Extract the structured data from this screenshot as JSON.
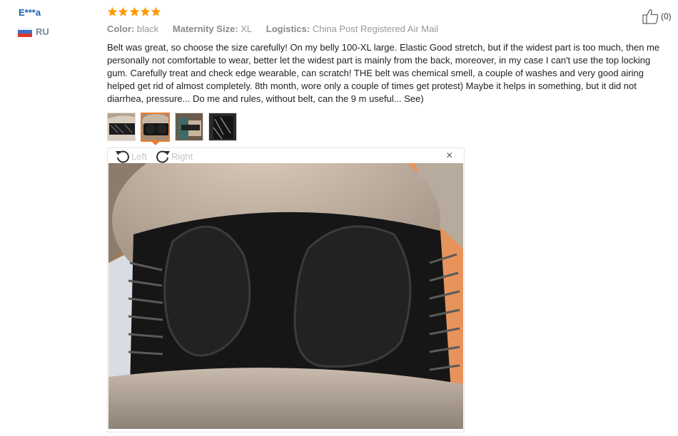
{
  "user": {
    "name": "E***a",
    "country": "RU"
  },
  "review": {
    "rating": 5,
    "attributes": [
      {
        "label": "Color:",
        "value": "black"
      },
      {
        "label": "Maternity Size:",
        "value": "XL"
      },
      {
        "label": "Logistics:",
        "value": "China Post Registered Air Mail"
      }
    ],
    "text": "Belt was great, so choose the size carefully! On my belly 100-XL large. Elastic Good stretch, but if the widest part is too much, then me personally not comfortable to wear, better let the widest part is mainly from the back, moreover, in my case I can't use the top locking gum. Carefully treat and check edge wearable, can scratch! THE belt was chemical smell, a couple of washes and very good airing helped get rid of almost completely. 8th month, wore only a couple of times get protest) Maybe it helps in something, but it did not diarrhea, pressure... Do me and rules, without belt, can the 9 m useful... See)",
    "likes": "(0)"
  },
  "thumbnails": {
    "count": 4,
    "active_index": 1
  },
  "viewer": {
    "rotate_left_label": "Left",
    "rotate_right_label": "Right",
    "close_label": "×"
  },
  "colors": {
    "star": "#ff9a00",
    "username": "#1a5fb4",
    "accent": "#f07b2c"
  },
  "icons": [
    "star-icon",
    "thumbs-up-icon",
    "rotate-left-icon",
    "rotate-right-icon",
    "close-icon",
    "russia-flag-icon"
  ]
}
